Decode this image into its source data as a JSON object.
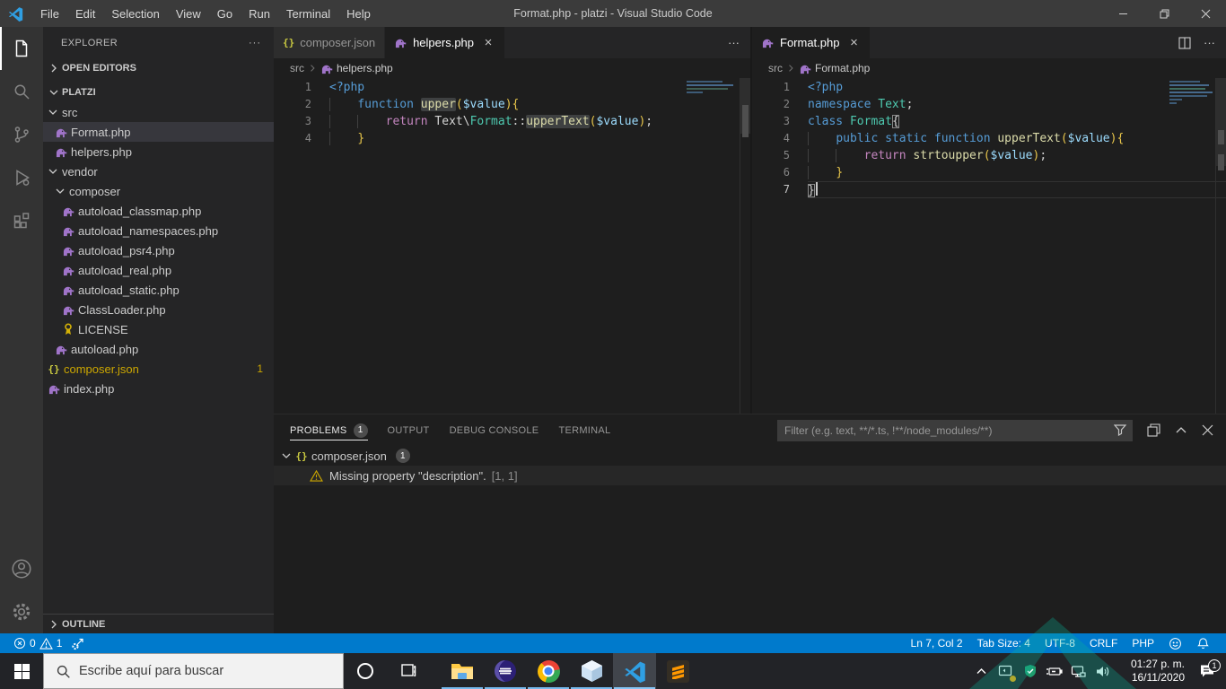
{
  "title_bar": {
    "title": "Format.php - platzi - Visual Studio Code",
    "menus": [
      "File",
      "Edit",
      "Selection",
      "View",
      "Go",
      "Run",
      "Terminal",
      "Help"
    ]
  },
  "activity_bar": {
    "items": [
      "explorer",
      "search",
      "source-control",
      "run-debug",
      "extensions"
    ],
    "bottom": [
      "account",
      "settings"
    ]
  },
  "sidebar": {
    "header": "EXPLORER",
    "sections": {
      "open_editors": "OPEN EDITORS",
      "workspace": "PLATZI",
      "outline": "OUTLINE"
    },
    "tree": [
      {
        "label": "src",
        "type": "folder",
        "depth": 1,
        "expanded": true
      },
      {
        "label": "Format.php",
        "type": "php",
        "depth": 2,
        "selected": true
      },
      {
        "label": "helpers.php",
        "type": "php",
        "depth": 2
      },
      {
        "label": "vendor",
        "type": "folder",
        "depth": 1,
        "expanded": true
      },
      {
        "label": "composer",
        "type": "folder",
        "depth": 2,
        "expanded": true
      },
      {
        "label": "autoload_classmap.php",
        "type": "php",
        "depth": 3
      },
      {
        "label": "autoload_namespaces.php",
        "type": "php",
        "depth": 3
      },
      {
        "label": "autoload_psr4.php",
        "type": "php",
        "depth": 3
      },
      {
        "label": "autoload_real.php",
        "type": "php",
        "depth": 3
      },
      {
        "label": "autoload_static.php",
        "type": "php",
        "depth": 3
      },
      {
        "label": "ClassLoader.php",
        "type": "php",
        "depth": 3
      },
      {
        "label": "LICENSE",
        "type": "license",
        "depth": 3
      },
      {
        "label": "autoload.php",
        "type": "php",
        "depth": 2
      },
      {
        "label": "composer.json",
        "type": "json",
        "depth": 1,
        "badge": "1",
        "warn": true
      },
      {
        "label": "index.php",
        "type": "php",
        "depth": 1
      }
    ]
  },
  "editors": [
    {
      "tabs": [
        {
          "label": "composer.json",
          "icon": "json",
          "active": false
        },
        {
          "label": "helpers.php",
          "icon": "php",
          "active": true,
          "close": true
        }
      ],
      "actions": [
        "more"
      ],
      "breadcrumb": [
        "src",
        "helpers.php"
      ],
      "code": [
        [
          [
            "<?php",
            "kw"
          ]
        ],
        [
          [
            "    ",
            "ind"
          ],
          [
            "function",
            "kw"
          ],
          [
            " ",
            "pun"
          ],
          [
            "upper",
            "fn hl"
          ],
          [
            "(",
            "br"
          ],
          [
            "$value",
            "var"
          ],
          [
            ")",
            "br"
          ],
          [
            "{",
            "br"
          ]
        ],
        [
          [
            "    ",
            "ind"
          ],
          [
            "    ",
            "ind"
          ],
          [
            "return",
            "ctl"
          ],
          [
            " ",
            "pun"
          ],
          [
            "Text",
            "pun"
          ],
          [
            "\\",
            "pun"
          ],
          [
            "Format",
            "cls"
          ],
          [
            "::",
            "pun"
          ],
          [
            "upperText",
            "fn hl"
          ],
          [
            "(",
            "br"
          ],
          [
            "$value",
            "var"
          ],
          [
            ")",
            "br"
          ],
          [
            ";",
            "pun"
          ]
        ],
        [
          [
            "    ",
            "ind"
          ],
          [
            "}",
            "br"
          ]
        ]
      ]
    },
    {
      "tabs": [
        {
          "label": "Format.php",
          "icon": "php",
          "active": true,
          "close": true
        }
      ],
      "actions": [
        "split",
        "more"
      ],
      "breadcrumb": [
        "src",
        "Format.php"
      ],
      "cursor_line": 7,
      "code": [
        [
          [
            "<?php",
            "kw"
          ]
        ],
        [
          [
            "namespace",
            "kw"
          ],
          [
            " ",
            "pun"
          ],
          [
            "Text",
            "cls"
          ],
          [
            ";",
            "pun"
          ]
        ],
        [
          [
            "class",
            "kw"
          ],
          [
            " ",
            "pun"
          ],
          [
            "Format",
            "cls"
          ],
          [
            "{",
            "pun box"
          ]
        ],
        [
          [
            "    ",
            "ind"
          ],
          [
            "public",
            "kw"
          ],
          [
            " ",
            "pun"
          ],
          [
            "static",
            "kw"
          ],
          [
            " ",
            "pun"
          ],
          [
            "function",
            "kw"
          ],
          [
            " ",
            "pun"
          ],
          [
            "upperText",
            "fn"
          ],
          [
            "(",
            "br"
          ],
          [
            "$value",
            "var"
          ],
          [
            ")",
            "br"
          ],
          [
            "{",
            "br"
          ]
        ],
        [
          [
            "    ",
            "ind"
          ],
          [
            "    ",
            "ind"
          ],
          [
            "return",
            "ctl"
          ],
          [
            " ",
            "pun"
          ],
          [
            "strtoupper",
            "fn"
          ],
          [
            "(",
            "br"
          ],
          [
            "$value",
            "var"
          ],
          [
            ")",
            "br"
          ],
          [
            ";",
            "pun"
          ]
        ],
        [
          [
            "    ",
            "ind"
          ],
          [
            "}",
            "br"
          ]
        ],
        [
          [
            "}",
            "pun box"
          ]
        ]
      ]
    }
  ],
  "panel": {
    "tabs": [
      {
        "label": "PROBLEMS",
        "badge": "1",
        "active": true
      },
      {
        "label": "OUTPUT"
      },
      {
        "label": "DEBUG CONSOLE"
      },
      {
        "label": "TERMINAL"
      }
    ],
    "filter_placeholder": "Filter (e.g. text, **/*.ts, !**/node_modules/**)",
    "problems": {
      "file": {
        "label": "composer.json",
        "badge": "1",
        "icon": "json"
      },
      "items": [
        {
          "severity": "warning",
          "message": "Missing property \"description\".",
          "location": "[1, 1]"
        }
      ]
    }
  },
  "status_bar": {
    "errors": "0",
    "warnings": "1",
    "right": [
      "Ln 7, Col 2",
      "Tab Size: 4",
      "UTF-8",
      "CRLF",
      "PHP"
    ]
  },
  "taskbar": {
    "search_placeholder": "Escribe aquí para buscar",
    "apps": [
      "file-explorer",
      "eclipse",
      "chrome",
      "virtualbox",
      "vscode",
      "sublime"
    ],
    "running_apps": [
      "file-explorer",
      "eclipse",
      "chrome",
      "virtualbox",
      "vscode"
    ],
    "active_app": "vscode",
    "clock": {
      "time": "01:27 p. m.",
      "date": "16/11/2020"
    },
    "notification_badge": "1"
  },
  "colors": {
    "status_bar": "#007acc",
    "title_bar": "#3b3b3b",
    "activity_bar": "#333333",
    "sidebar": "#252526",
    "editor": "#1e1e1e",
    "tab_inactive": "#2d2d2d",
    "selection_row": "#37373d",
    "warning": "#cca700",
    "php_icon": "#a074c9",
    "json_icon": "#cbcb41",
    "running_indicator": "#76b9ed",
    "tokens": {
      "kw": "#569cd6",
      "ctl": "#c586c0",
      "fn": "#dcdcaa",
      "var": "#9cdcfe",
      "cls": "#4ec9b0",
      "pun": "#d4d4d4",
      "br": "#e8c64b"
    }
  }
}
